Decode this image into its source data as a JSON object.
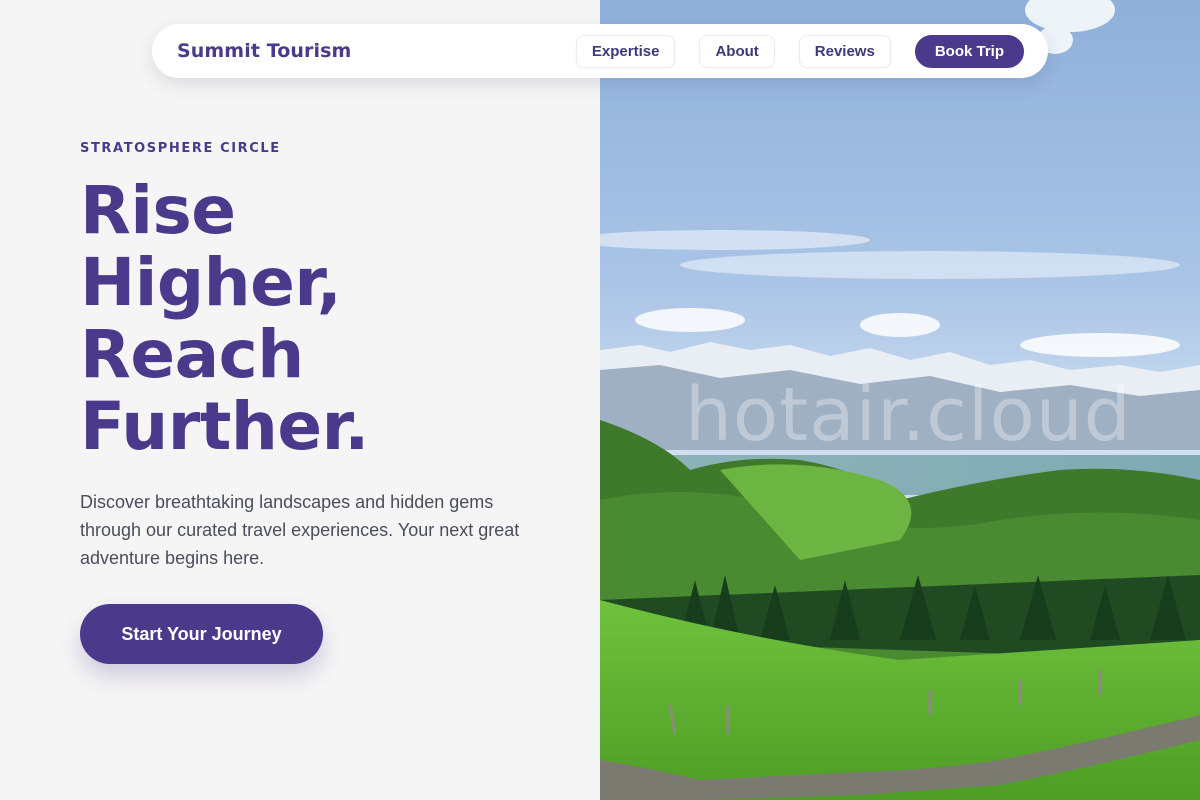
{
  "nav": {
    "brand": "Summit Tourism",
    "links": [
      {
        "label": "Expertise"
      },
      {
        "label": "About"
      },
      {
        "label": "Reviews"
      }
    ],
    "cta": "Book Trip"
  },
  "hero": {
    "kicker": "STRATOSPHERE CIRCLE",
    "title_lines": [
      "Rise",
      "Higher,",
      "Reach",
      "Further."
    ],
    "description": "Discover breathtaking landscapes and hidden gems through our curated travel experiences. Your next great adventure begins here.",
    "cta": "Start Your Journey"
  },
  "image": {
    "watermark": "hotair.cloud",
    "alt": "alpine-mountain-landscape"
  },
  "colors": {
    "brand": "#4b3a8c",
    "background": "#f5f5f5",
    "text_muted": "#4a4d5c"
  }
}
